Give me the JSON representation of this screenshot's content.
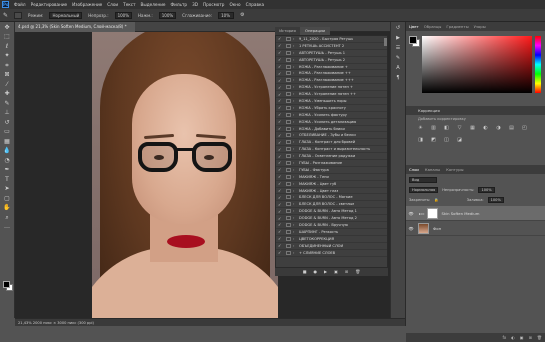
{
  "menu": {
    "logo": "Ps",
    "items": [
      "Файл",
      "Редактирование",
      "Изображение",
      "Слои",
      "Текст",
      "Выделение",
      "Фильтр",
      "3D",
      "Просмотр",
      "Окно",
      "Справка"
    ]
  },
  "options": {
    "mode_label": "Режим:",
    "mode_value": "Нормальный",
    "opacity_label": "Непрозр.:",
    "opacity_value": "100%",
    "flow_label": "Нажм.:",
    "flow_value": "100%",
    "smooth_label": "Сглаживание:",
    "smooth_value": "10%"
  },
  "document": {
    "tab_title": "4.psd @ 21,3% (Skin Soften Medium, Слой-маска/8) *"
  },
  "actions_panel": {
    "tab_history": "История",
    "tab_operations": "Операции",
    "rows": [
      "9_11_2020 - Быстрая Ретушь",
      "1 РЕТУШЬ АССИСТЕНТ 2",
      "АВТОРЕТУШЬ - Ретушь 1",
      "АВТОРЕТУШЬ - Ретушь 2",
      "КОЖА - Разглаживание +",
      "КОЖА - Разглаживание ++",
      "КОЖА - Разглаживание +++",
      "КОЖА - Устранение пятен +",
      "КОЖА - Устранение пятен ++",
      "КОЖА - Уменьшить поры",
      "КОЖА - Убрать красноту",
      "КОЖА - Усилить фактуру",
      "КОЖА - Усилить детализацию",
      "КОЖА - Добавить блики",
      "ОТБЕЛИВАНИЕ - Зубы и белки",
      "ГЛАЗА - Контраст для бровей",
      "ГЛАЗА - Контраст и выразительность",
      "ГЛАЗА - Осветление радужки",
      "ГУБЫ - Разглаживание",
      "ГУБЫ - Фактура",
      "МАКИЯЖ - Тени",
      "МАКИЯЖ - Цвет губ",
      "МАКИЯЖ - Цвет глаз",
      "БЛЕСК ДЛЯ ВОЛОС - Мягкие",
      "БЛЕСК ДЛЯ ВОЛОС - светлые",
      "DODGE & BURN - Авто Метод 1",
      "DODGE & BURN - Авто Метод 2",
      "DODGE & BURN - Вручную",
      "ШАРПИНГ - Резкость",
      "ЦВЕТОКОРРЕКЦИЯ",
      "ОБЪЕДИНЕННЫЙ СЛОЙ",
      "+ СЛИЯНИЕ СЛОЕВ"
    ],
    "bottom_icons": [
      "■",
      "●",
      "▶",
      "▣",
      "⊞",
      "🗑"
    ]
  },
  "right_panel": {
    "tabs": [
      "Цвет",
      "Образцы",
      "Градиенты",
      "Узоры"
    ],
    "corrections_title": "Коррекция",
    "corrections_sub": "Добавить корректировку",
    "corr_icons": [
      "☀",
      "▥",
      "◧",
      "▽",
      "▦",
      "◐",
      "◑",
      "▤",
      "◰",
      "◨",
      "◩",
      "◫",
      "◪"
    ],
    "layers_tabs": [
      "Слои",
      "Каналы",
      "Контуры"
    ],
    "kind_label": "Вид",
    "blend_value": "Нормальная",
    "opacity_label": "Непрозрачность:",
    "opacity_value": "100%",
    "lock_label": "Закрепить:",
    "fill_label": "Заливка:",
    "fill_value": "100%",
    "layers": [
      {
        "name": "Skin Soften Medium",
        "selected": true
      },
      {
        "name": "Фон",
        "selected": false
      }
    ],
    "bottom_icons": [
      "fx",
      "◐",
      "▣",
      "⊞",
      "🗑"
    ]
  },
  "status": {
    "text": "21,43%   2000 пикс × 3000 пикс (300 ppi)"
  },
  "colors": {
    "accent": "#3a8ee6",
    "lip_red": "#a80f1f"
  }
}
